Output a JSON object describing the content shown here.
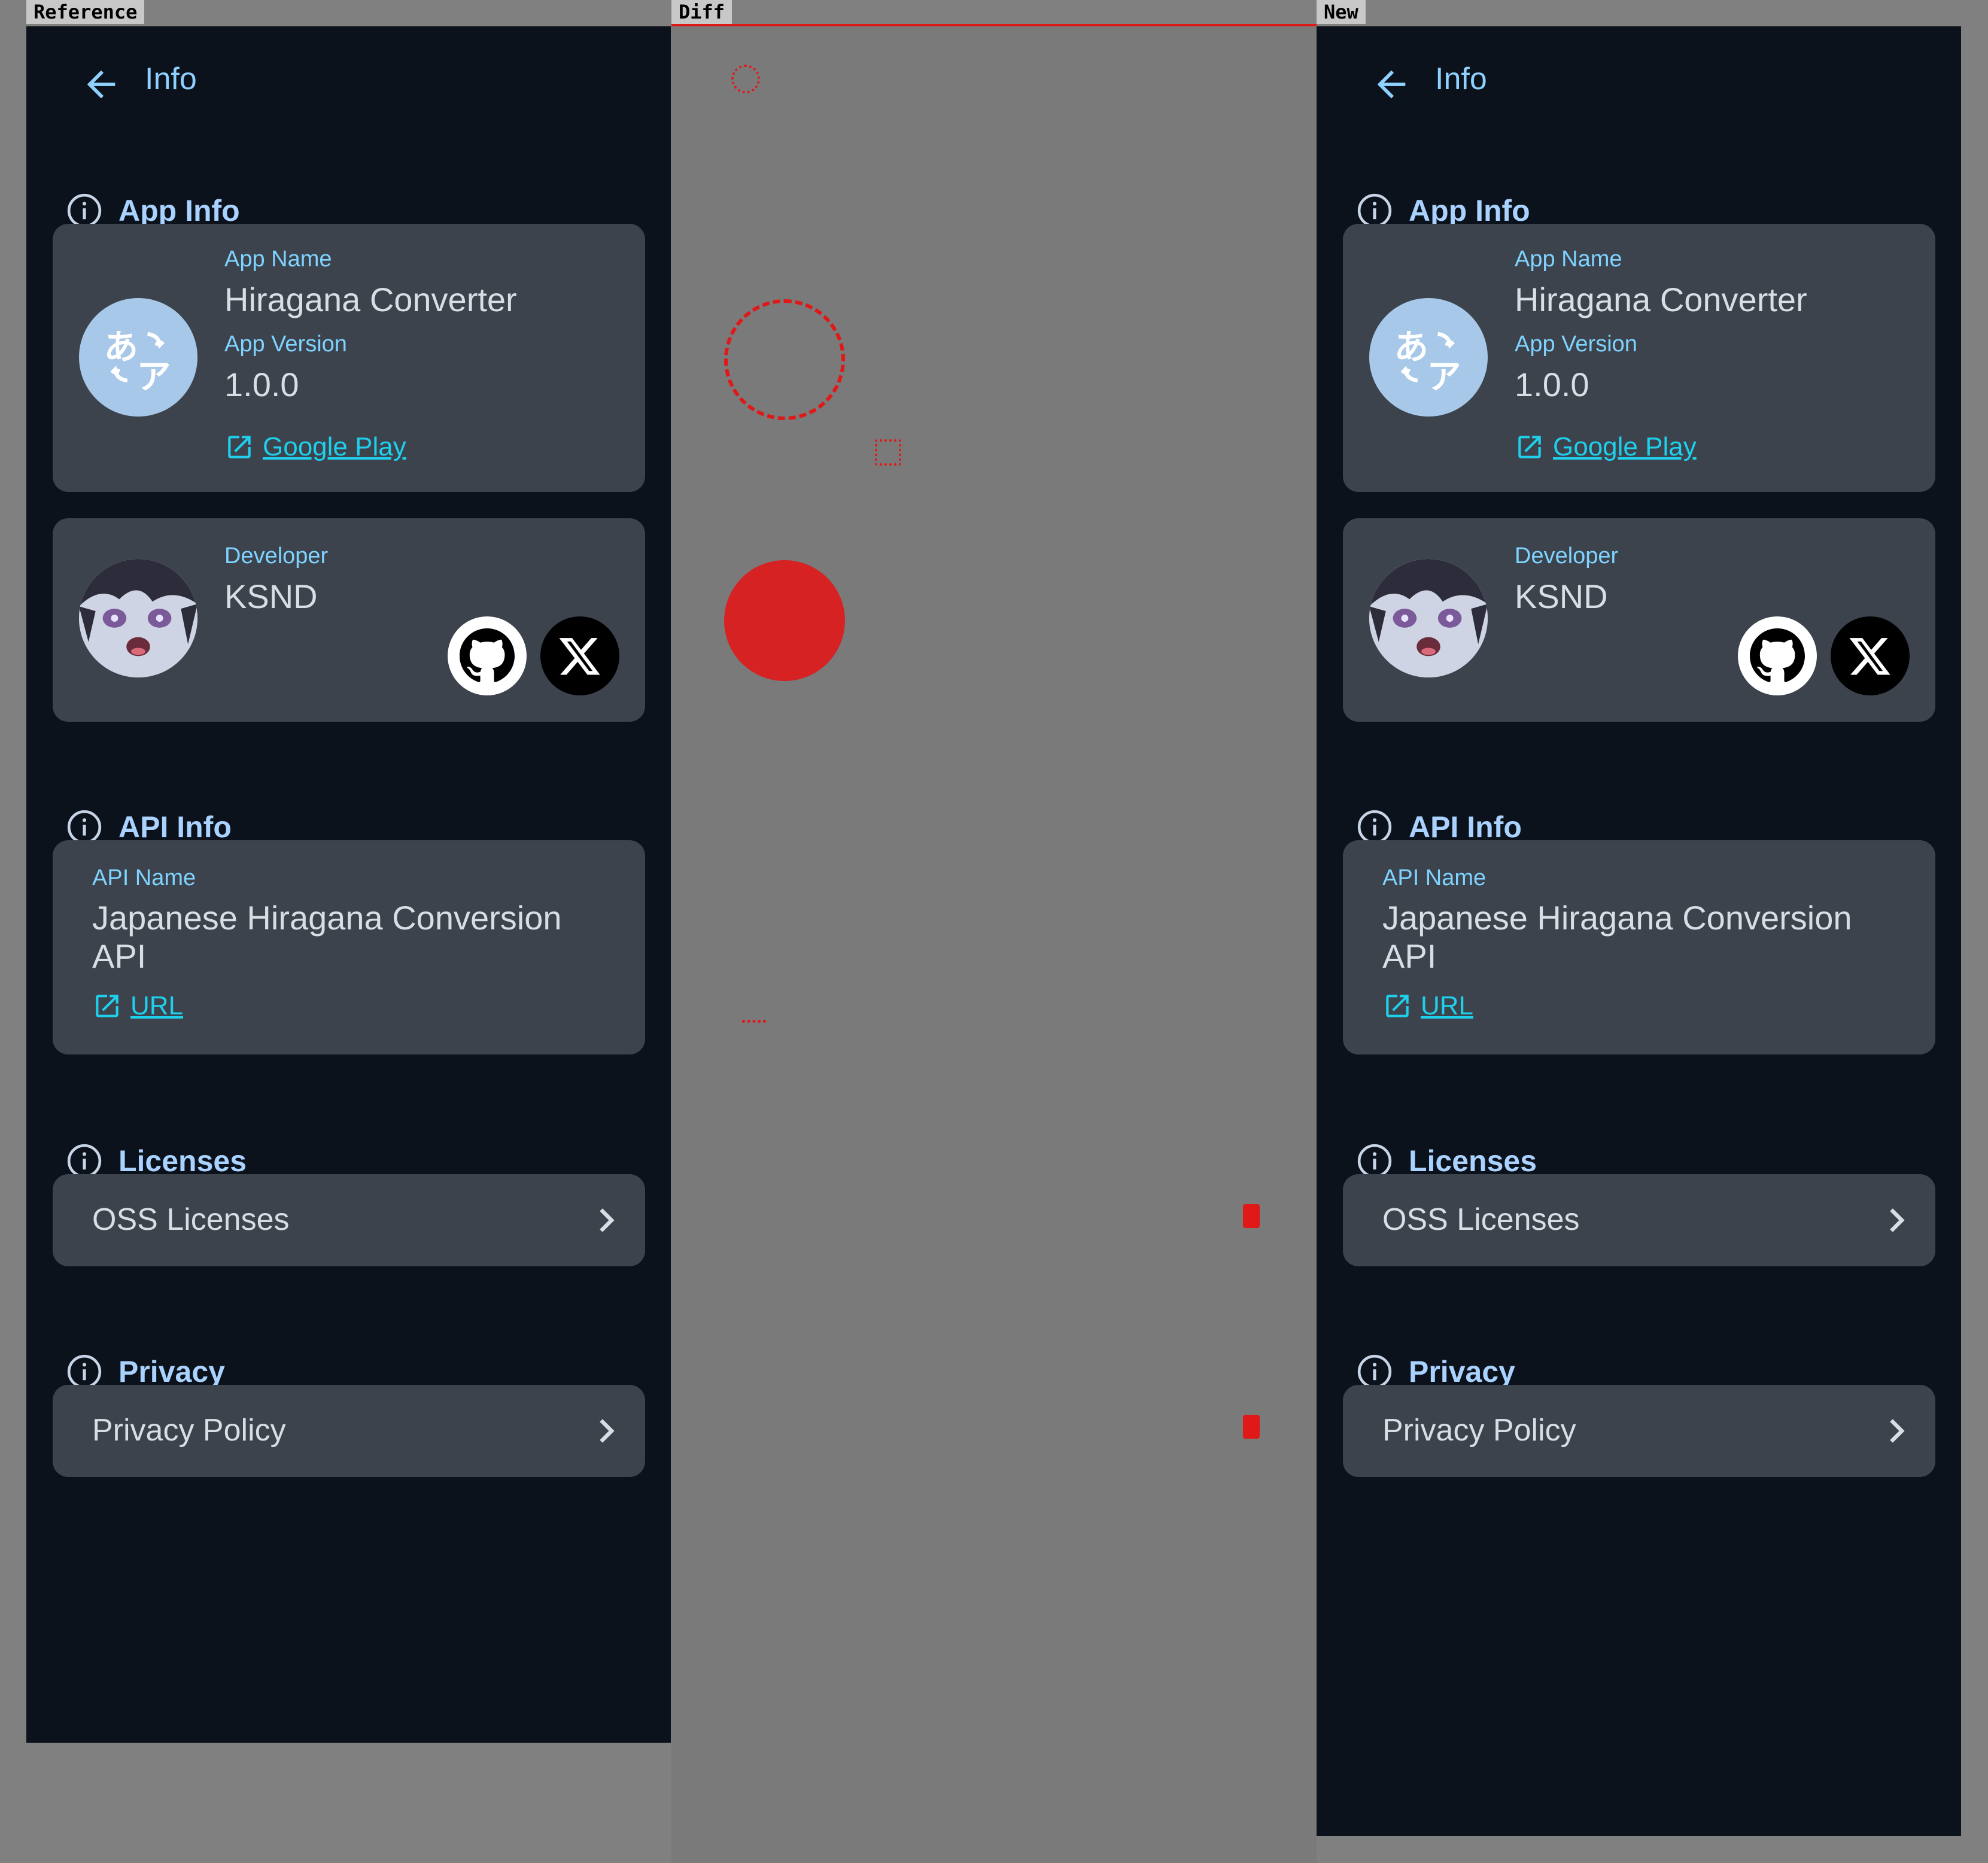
{
  "strips": {
    "reference": "Reference",
    "diff": "Diff",
    "new": "New"
  },
  "screen": {
    "title": "Info",
    "sections": {
      "app_info": "App Info",
      "api_info": "API Info",
      "licenses": "Licenses",
      "privacy": "Privacy"
    },
    "app": {
      "name_label": "App Name",
      "name": "Hiragana Converter",
      "version_label": "App Version",
      "version": "1.0.0",
      "store_link": "Google Play"
    },
    "developer": {
      "label": "Developer",
      "name": "KSND"
    },
    "api": {
      "name_label": "API Name",
      "name": "Japanese Hiragana Conversion API",
      "link": "URL"
    },
    "licenses_row": "OSS Licenses",
    "privacy_row": "Privacy Policy"
  },
  "colors": {
    "background": "#0c121b",
    "card": "#3c434d",
    "accent_label": "#7fd3ff",
    "section_title": "#a9d2ff",
    "link": "#1ed0ec",
    "diff_mark": "#e01818"
  },
  "icons": [
    "back-arrow-icon",
    "info-circle-icon",
    "external-link-icon",
    "github-icon",
    "x-icon",
    "chevron-right-icon"
  ]
}
